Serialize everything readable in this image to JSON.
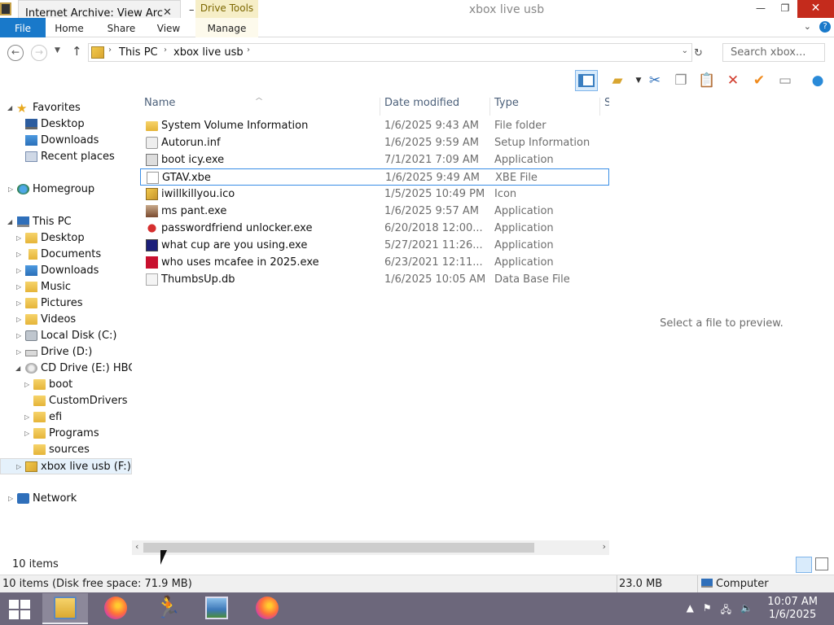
{
  "window": {
    "tab_title": "Internet Archive: View Arc",
    "context_tab": "Drive Tools",
    "title": "xbox live usb",
    "controls": {
      "minimize": "—",
      "maximize": "❐",
      "close": "✕"
    }
  },
  "ribbon": {
    "tabs": [
      "File",
      "Home",
      "Share",
      "View",
      "Manage"
    ]
  },
  "address": {
    "crumbs": [
      "This PC",
      "xbox live usb"
    ],
    "search_placeholder": "Search xbox..."
  },
  "nav": {
    "favorites": {
      "label": "Favorites",
      "items": [
        "Desktop",
        "Downloads",
        "Recent places"
      ]
    },
    "homegroup": "Homegroup",
    "this_pc": {
      "label": "This PC",
      "items": [
        "Desktop",
        "Documents",
        "Downloads",
        "Music",
        "Pictures",
        "Videos",
        "Local Disk (C:)",
        "Drive (D:)",
        "CD Drive (E:) HBC"
      ],
      "cd_children": [
        "boot",
        "CustomDrivers",
        "efi",
        "Programs",
        "sources"
      ],
      "usb": "xbox live usb (F:)"
    },
    "network": "Network"
  },
  "columns": {
    "name": "Name",
    "date": "Date modified",
    "type": "Type",
    "size": "S"
  },
  "files": [
    {
      "name": "System Volume Information",
      "date": "1/6/2025 9:43 AM",
      "type": "File folder",
      "icon": "folder-icon"
    },
    {
      "name": "Autorun.inf",
      "date": "1/6/2025 9:59 AM",
      "type": "Setup Information",
      "icon": "inf-file-icon"
    },
    {
      "name": "boot icy.exe",
      "date": "7/1/2021 7:09 AM",
      "type": "Application",
      "icon": "exe-icon"
    },
    {
      "name": "GTAV.xbe",
      "date": "1/6/2025 9:49 AM",
      "type": "XBE File",
      "icon": "blank-file-icon"
    },
    {
      "name": "iwillkillyou.ico",
      "date": "1/5/2025 10:49 PM",
      "type": "Icon",
      "icon": "ico-file-icon"
    },
    {
      "name": "ms pant.exe",
      "date": "1/6/2025 9:57 AM",
      "type": "Application",
      "icon": "paint-icon"
    },
    {
      "name": "passwordfriend unlocker.exe",
      "date": "6/20/2018 12:00...",
      "type": "Application",
      "icon": "password-tool-icon"
    },
    {
      "name": "what cup are you using.exe",
      "date": "5/27/2021 11:26...",
      "type": "Application",
      "icon": "cup-app-icon"
    },
    {
      "name": "who uses mcafee in 2025.exe",
      "date": "6/23/2021 12:11...",
      "type": "Application",
      "icon": "mcafee-icon"
    },
    {
      "name": "ThumbsUp.db",
      "date": "1/6/2025 10:05 AM",
      "type": "Data Base File",
      "icon": "db-file-icon"
    }
  ],
  "preview": {
    "message": "Select a file to preview."
  },
  "status": {
    "items": "10 items"
  },
  "details_bar": {
    "summary": "10 items (Disk free space: 71.9 MB)",
    "size": "23.0 MB",
    "location": "Computer"
  },
  "taskbar": {
    "clock_time": "10:07 AM",
    "clock_date": "1/6/2025"
  }
}
